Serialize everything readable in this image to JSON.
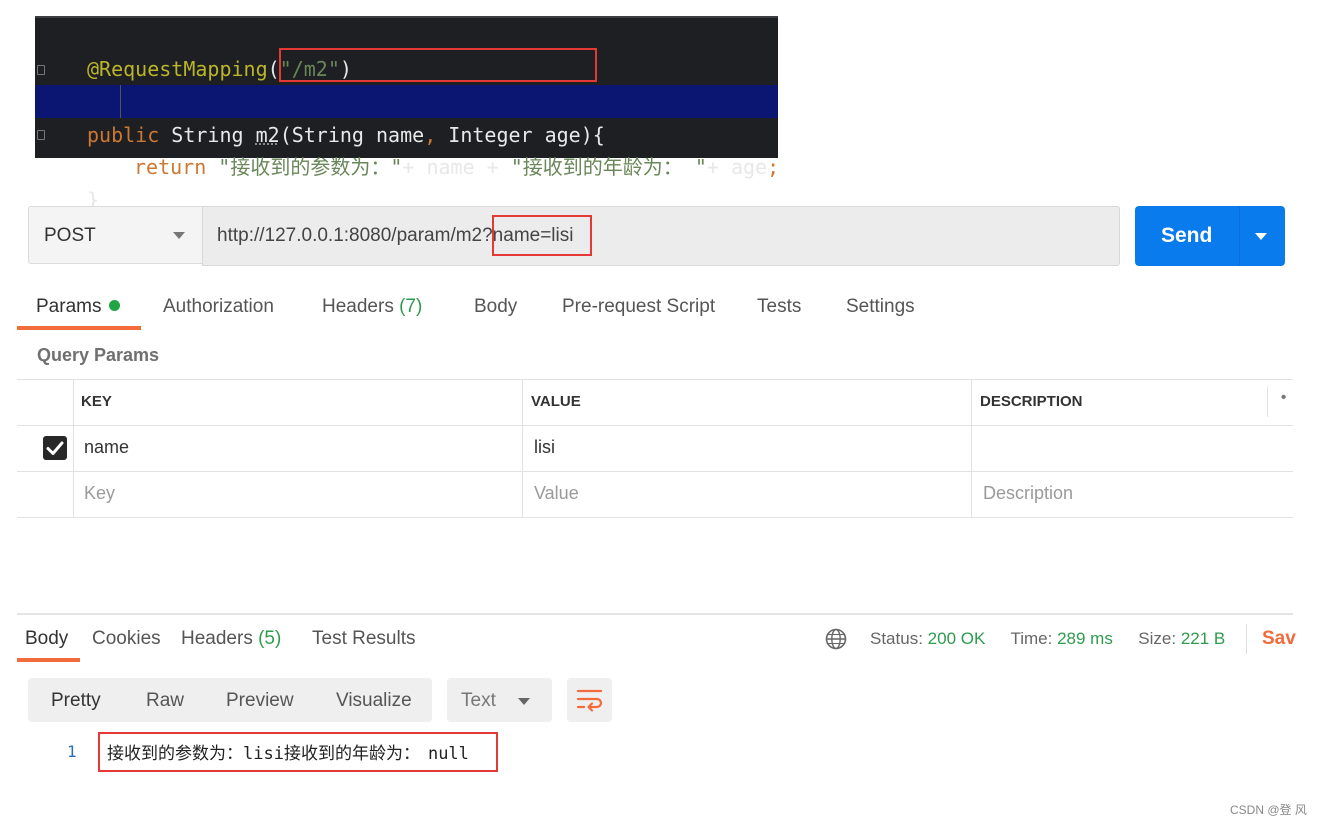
{
  "code": {
    "annotation": "@RequestMapping",
    "mapping_path": "\"/m2\"",
    "kw_public": "public",
    "type_string": "String",
    "method_name": "m2",
    "params_part1": "(String name",
    "params_comma": ",",
    "params_part2": " Integer age)",
    "open_brace": "{",
    "kw_return": "return",
    "str1": "\"接收到的参数为：\"",
    "concat1": "+ name + ",
    "str2": "\"接收到的年龄为： \"",
    "concat2": "+ age",
    "semicolon": ";",
    "close_brace": "}"
  },
  "request": {
    "method": "POST",
    "url": "http://127.0.0.1:8080/param/m2?name=lisi",
    "send_label": "Send"
  },
  "tabs": {
    "params": "Params",
    "authorization": "Authorization",
    "headers": "Headers",
    "headers_count": "(7)",
    "body": "Body",
    "pre_request": "Pre-request Script",
    "tests": "Tests",
    "settings": "Settings"
  },
  "query_params": {
    "title": "Query Params",
    "headers": {
      "key": "KEY",
      "value": "VALUE",
      "description": "DESCRIPTION"
    },
    "rows": [
      {
        "checked": true,
        "key": "name",
        "value": "lisi",
        "description": ""
      }
    ],
    "placeholder": {
      "key": "Key",
      "value": "Value",
      "description": "Description"
    }
  },
  "response": {
    "tabs": {
      "body": "Body",
      "cookies": "Cookies",
      "headers": "Headers",
      "headers_count": "(5)",
      "test_results": "Test Results"
    },
    "status_label": "Status:",
    "status_value": "200 OK",
    "time_label": "Time:",
    "time_value": "289 ms",
    "size_label": "Size:",
    "size_value": "221 B",
    "save_label": "Sav",
    "formats": [
      "Pretty",
      "Raw",
      "Preview",
      "Visualize"
    ],
    "text_type": "Text",
    "line_number": "1",
    "body_prefix": "接收到的参数为：",
    "body_name": "lisi",
    "body_middle": "接收到的年龄为：",
    "body_null": "null"
  },
  "watermark": "CSDN @登 风",
  "colors": {
    "accent": "#f26b3a",
    "send": "#097bed",
    "ok": "#2e9c4e",
    "highlight_box": "#e53935"
  }
}
